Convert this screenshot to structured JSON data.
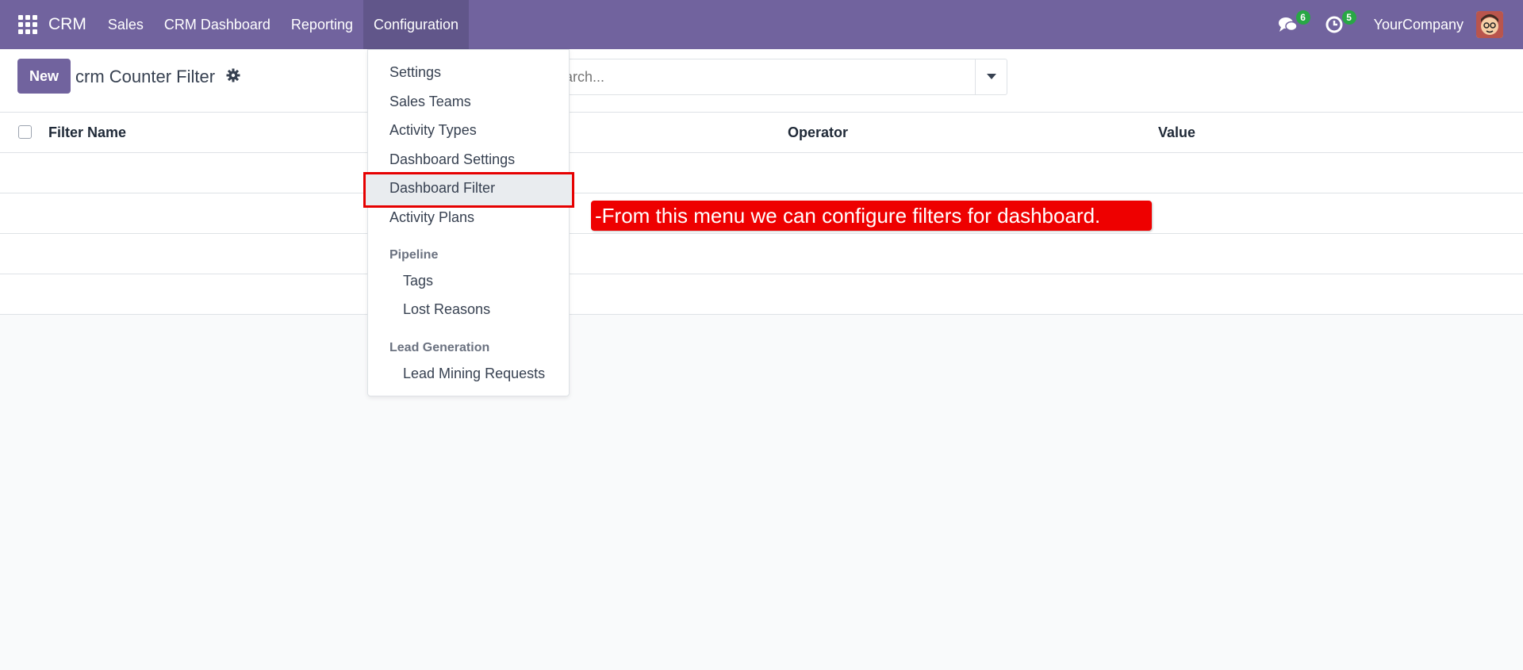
{
  "navbar": {
    "brand": "CRM",
    "menu": [
      "Sales",
      "CRM Dashboard",
      "Reporting",
      "Configuration"
    ],
    "messages_count": "6",
    "activities_count": "5",
    "company": "YourCompany",
    "color": "#71639e"
  },
  "control": {
    "new_label": "New",
    "title": "crm Counter Filter",
    "search_placeholder": "Search..."
  },
  "table": {
    "columns": [
      "Filter Name",
      "Operator",
      "Value"
    ]
  },
  "config_menu": {
    "items": [
      "Settings",
      "Sales Teams",
      "Activity Types",
      "Dashboard Settings",
      "Dashboard Filter",
      "Activity Plans"
    ],
    "pipeline_header": "Pipeline",
    "pipeline_items": [
      "Tags",
      "Lost Reasons"
    ],
    "lead_header": "Lead Generation",
    "lead_items": [
      "Lead Mining Requests"
    ]
  },
  "annotation": {
    "text": "-From this menu we can configure filters for dashboard.",
    "color": "#ee0000"
  }
}
